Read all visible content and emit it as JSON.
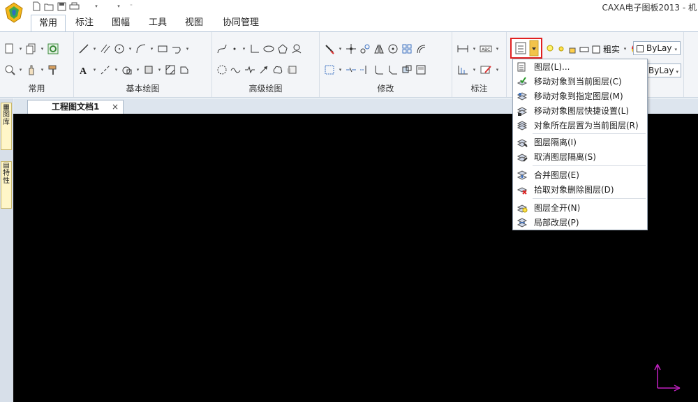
{
  "window": {
    "title": "CAXA电子图板2013 - 机"
  },
  "ribbon_tabs": [
    "常用",
    "标注",
    "图幅",
    "工具",
    "视图",
    "协同管理"
  ],
  "ribbon_groups": {
    "common": "常用",
    "basic_draw": "基本绘图",
    "advanced_draw": "高级绘图",
    "modify": "修改",
    "annotate": "标注"
  },
  "properties": {
    "linetype_label": "粗实",
    "color_value": "ByLay",
    "color_value2": "ByLay"
  },
  "document": {
    "tab_label": "工程图文档1",
    "close_glyph": "×"
  },
  "left_dock": {
    "tab1_text": "图\n库",
    "tab2_text": "特\n性"
  },
  "layer_menu": {
    "items": [
      {
        "label": "图层(L)...",
        "icon": "layer-icon"
      },
      {
        "label": "移动对象到当前图层(C)",
        "icon": "move-to-current-layer-icon"
      },
      {
        "label": "移动对象到指定图层(M)",
        "icon": "move-to-layer-icon"
      },
      {
        "label": "移动对象图层快捷设置(L)",
        "icon": "layer-quick-setting-icon"
      },
      {
        "label": "对象所在层置为当前图层(R)",
        "icon": "set-current-layer-icon"
      },
      {
        "label": "图层隔离(I)",
        "icon": "layer-isolate-icon"
      },
      {
        "label": "取消图层隔离(S)",
        "icon": "layer-unisolate-icon"
      },
      {
        "label": "合并图层(E)",
        "icon": "merge-layers-icon"
      },
      {
        "label": "拾取对象删除图层(D)",
        "icon": "delete-layer-icon"
      },
      {
        "label": "图层全开(N)",
        "icon": "layers-all-on-icon"
      },
      {
        "label": "局部改层(P)",
        "icon": "partial-change-layer-icon"
      }
    ]
  },
  "colors": {
    "ribbon_bg": "#f3f5f8",
    "canvas_bg": "#000000",
    "highlight": "#e02020",
    "axis": "#c020c0"
  }
}
